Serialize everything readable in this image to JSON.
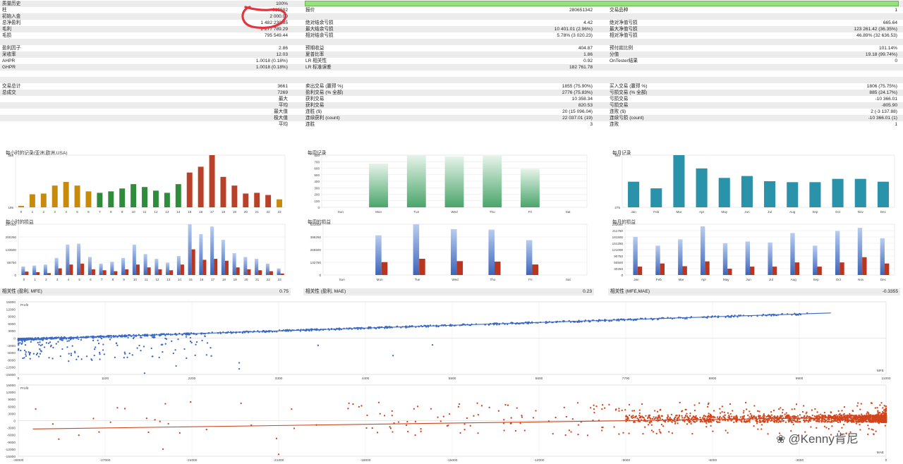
{
  "stats": {
    "rows": [
      {
        "cells": [
          {
            "t": "质量历史",
            "x": 3,
            "a": "l"
          },
          {
            "t": "100%",
            "x": 408,
            "a": "r"
          }
        ]
      },
      {
        "cells": [
          {
            "t": "柱",
            "x": 3,
            "a": "l"
          },
          {
            "t": "615592",
            "x": 408,
            "a": "r"
          },
          {
            "t": "报价",
            "x": 433,
            "a": "l"
          },
          {
            "t": "280651342",
            "x": 840,
            "a": "r"
          },
          {
            "t": "交易品种",
            "x": 864,
            "a": "l"
          },
          {
            "t": "1",
            "x": 1272,
            "a": "r"
          }
        ]
      },
      {
        "cells": [
          {
            "t": "初始入金",
            "x": 3,
            "a": "l"
          },
          {
            "t": "2 000.00",
            "x": 408,
            "a": "r"
          }
        ]
      },
      {
        "cells": [
          {
            "t": "总净盈利",
            "x": 3,
            "a": "l"
          },
          {
            "t": "1 482 239.85",
            "x": 408,
            "a": "r"
          },
          {
            "t": "绝对结余亏损",
            "x": 433,
            "a": "l"
          },
          {
            "t": "4.42",
            "x": 840,
            "a": "r"
          },
          {
            "t": "绝对净值亏损",
            "x": 864,
            "a": "l"
          },
          {
            "t": "665.64",
            "x": 1272,
            "a": "r"
          }
        ]
      },
      {
        "cells": [
          {
            "t": "毛利",
            "x": 3,
            "a": "l"
          },
          {
            "t": "2 277 789.29",
            "x": 408,
            "a": "r"
          },
          {
            "t": "最大结余亏损",
            "x": 433,
            "a": "l"
          },
          {
            "t": "10 401.01 (2.96%)",
            "x": 840,
            "a": "r"
          },
          {
            "t": "最大净值亏损",
            "x": 864,
            "a": "l"
          },
          {
            "t": "123 261.42 (36.35%)",
            "x": 1272,
            "a": "r"
          }
        ]
      },
      {
        "cells": [
          {
            "t": "毛损",
            "x": 3,
            "a": "l"
          },
          {
            "t": "795 549.44",
            "x": 408,
            "a": "r"
          },
          {
            "t": "相对结余亏损",
            "x": 433,
            "a": "l"
          },
          {
            "t": "5.78% (3 020.23)",
            "x": 840,
            "a": "r"
          },
          {
            "t": "相对净值亏损",
            "x": 864,
            "a": "l"
          },
          {
            "t": "46.89% (32 636.53)",
            "x": 1272,
            "a": "r"
          }
        ]
      },
      {
        "cells": []
      },
      {
        "cells": [
          {
            "t": "盈利因子",
            "x": 3,
            "a": "l"
          },
          {
            "t": "2.86",
            "x": 408,
            "a": "r"
          },
          {
            "t": "预期收益",
            "x": 433,
            "a": "l"
          },
          {
            "t": "404.87",
            "x": 840,
            "a": "r"
          },
          {
            "t": "预付款比例",
            "x": 864,
            "a": "l"
          },
          {
            "t": "101.14%",
            "x": 1272,
            "a": "r"
          }
        ]
      },
      {
        "cells": [
          {
            "t": "采收率",
            "x": 3,
            "a": "l"
          },
          {
            "t": "12.03",
            "x": 408,
            "a": "r"
          },
          {
            "t": "夏普比率",
            "x": 433,
            "a": "l"
          },
          {
            "t": "1.86",
            "x": 840,
            "a": "r"
          },
          {
            "t": "分值",
            "x": 864,
            "a": "l"
          },
          {
            "t": "19.18 (99.74%)",
            "x": 1272,
            "a": "r"
          }
        ]
      },
      {
        "cells": [
          {
            "t": "AHPR",
            "x": 3,
            "a": "l"
          },
          {
            "t": "1.0018 (0.18%)",
            "x": 408,
            "a": "r"
          },
          {
            "t": "LR 相关性",
            "x": 433,
            "a": "l"
          },
          {
            "t": "0.92",
            "x": 840,
            "a": "r"
          },
          {
            "t": "OnTester结果",
            "x": 864,
            "a": "l"
          },
          {
            "t": "0",
            "x": 1272,
            "a": "r"
          }
        ]
      },
      {
        "cells": [
          {
            "t": "GHPR",
            "x": 3,
            "a": "l"
          },
          {
            "t": "1.0018 (0.18%)",
            "x": 408,
            "a": "r"
          },
          {
            "t": "LR 标准误差",
            "x": 433,
            "a": "l"
          },
          {
            "t": "182 761.78",
            "x": 840,
            "a": "r"
          }
        ]
      },
      {
        "cells": []
      },
      {
        "cells": []
      },
      {
        "cells": [
          {
            "t": "交易总计",
            "x": 3,
            "a": "l"
          },
          {
            "t": "3661",
            "x": 408,
            "a": "r"
          },
          {
            "t": "卖出交易 (赢得 %)",
            "x": 433,
            "a": "l"
          },
          {
            "t": "1855 (75.90%)",
            "x": 840,
            "a": "r"
          },
          {
            "t": "买入交易 (赢得 %)",
            "x": 864,
            "a": "l"
          },
          {
            "t": "1806 (75.75%)",
            "x": 1272,
            "a": "r"
          }
        ]
      },
      {
        "cells": [
          {
            "t": "总成交",
            "x": 3,
            "a": "l"
          },
          {
            "t": "7269",
            "x": 408,
            "a": "r"
          },
          {
            "t": "盈利交易 (% 全部)",
            "x": 433,
            "a": "l"
          },
          {
            "t": "2776 (75.83%)",
            "x": 840,
            "a": "r"
          },
          {
            "t": "亏损交易 (% 全部)",
            "x": 864,
            "a": "l"
          },
          {
            "t": "885 (24.17%)",
            "x": 1272,
            "a": "r"
          }
        ]
      },
      {
        "cells": [
          {
            "t": "最大",
            "x": 408,
            "a": "r"
          },
          {
            "t": "获利交易",
            "x": 433,
            "a": "l"
          },
          {
            "t": "10 358.34",
            "x": 840,
            "a": "r"
          },
          {
            "t": "亏损交易",
            "x": 864,
            "a": "l"
          },
          {
            "t": "-10 366.01",
            "x": 1272,
            "a": "r"
          }
        ]
      },
      {
        "cells": [
          {
            "t": "平均",
            "x": 408,
            "a": "r"
          },
          {
            "t": "获利交易",
            "x": 433,
            "a": "l"
          },
          {
            "t": "820.53",
            "x": 840,
            "a": "r"
          },
          {
            "t": "亏损交易",
            "x": 864,
            "a": "l"
          },
          {
            "t": "-805.90",
            "x": 1272,
            "a": "r"
          }
        ]
      },
      {
        "cells": [
          {
            "t": "最大值",
            "x": 408,
            "a": "r"
          },
          {
            "t": "连胜 ($)",
            "x": 433,
            "a": "l"
          },
          {
            "t": "20 (15 096.04)",
            "x": 840,
            "a": "r"
          },
          {
            "t": "连败 ($)",
            "x": 864,
            "a": "l"
          },
          {
            "t": "2 (-3 137.88)",
            "x": 1272,
            "a": "r"
          }
        ]
      },
      {
        "cells": [
          {
            "t": "极大值",
            "x": 408,
            "a": "r"
          },
          {
            "t": "连续获利 (count)",
            "x": 433,
            "a": "l"
          },
          {
            "t": "22 037.01 (19)",
            "x": 840,
            "a": "r"
          },
          {
            "t": "连续亏损 (count)",
            "x": 864,
            "a": "l"
          },
          {
            "t": "-10 366.01 (1)",
            "x": 1272,
            "a": "r"
          }
        ]
      },
      {
        "cells": [
          {
            "t": "平均",
            "x": 408,
            "a": "r"
          },
          {
            "t": "连胜",
            "x": 433,
            "a": "l"
          },
          {
            "t": "3",
            "x": 840,
            "a": "r"
          },
          {
            "t": "连败",
            "x": 864,
            "a": "l"
          },
          {
            "t": "1",
            "x": 1272,
            "a": "r"
          }
        ]
      }
    ]
  },
  "quality_bar_pct": 100,
  "annotation_color": "#e8323c",
  "colors": {
    "hour_bars": [
      "#c78a0c",
      "#c78a0c",
      "#c78a0c",
      "#c78a0c",
      "#c78a0c",
      "#c78a0c",
      "#c78a0c",
      "#2f8c3a",
      "#2f8c3a",
      "#2f8c3a",
      "#2f8c3a",
      "#2f8c3a",
      "#2f8c3a",
      "#2f8c3a",
      "#2f8c3a",
      "#b9412a",
      "#b9412a",
      "#b9412a",
      "#b9412a",
      "#b9412a",
      "#b9412a",
      "#b9412a",
      "#b9412a",
      "#c78a0c"
    ],
    "week_bar": "#4aa56a",
    "month_bar": "#2b93a9",
    "pl_profit": "#3c64b8",
    "pl_loss": "#b8361f",
    "mfe_points": "#3a68c4",
    "mae_points": "#d0451c"
  },
  "chart_data": [
    {
      "id": "hour_records",
      "type": "bar",
      "title": "每小时的记录(亚洲,欧洲,USA)",
      "categories": [
        "0",
        "1",
        "2",
        "3",
        "4",
        "5",
        "6",
        "7",
        "8",
        "9",
        "10",
        "11",
        "12",
        "13",
        "14",
        "15",
        "16",
        "17",
        "18",
        "19",
        "20",
        "21",
        "22",
        "23"
      ],
      "values": [
        10,
        90,
        95,
        150,
        175,
        150,
        110,
        100,
        110,
        130,
        160,
        140,
        115,
        100,
        160,
        240,
        280,
        360,
        210,
        150,
        95,
        100,
        85,
        55
      ],
      "yticks": [
        "388",
        "195"
      ],
      "ylim": [
        0,
        360
      ]
    },
    {
      "id": "week_records",
      "type": "bar",
      "title": "每周记录",
      "categories": [
        "Sun",
        "Mon",
        "Tue",
        "Wed",
        "Thu",
        "Fri",
        "Sat"
      ],
      "values": [
        0,
        670,
        800,
        780,
        790,
        590,
        0
      ],
      "yticks": [
        "800",
        "700",
        "600",
        "500",
        "400",
        "300",
        "200",
        "100",
        "0"
      ],
      "ylim": [
        0,
        800
      ]
    },
    {
      "id": "month_records",
      "type": "bar",
      "title": "每月记录",
      "categories": [
        "Jan",
        "Feb",
        "Mar",
        "Apr",
        "May",
        "Jun",
        "Jul",
        "Aug",
        "Sep",
        "Oct",
        "Nov",
        "Dec"
      ],
      "values": [
        270,
        200,
        550,
        410,
        310,
        330,
        275,
        265,
        265,
        300,
        300,
        270
      ],
      "yticks": [
        "550",
        "275"
      ],
      "ylim": [
        0,
        550
      ]
    },
    {
      "id": "hour_pl",
      "type": "bar",
      "title": "每小时的损益",
      "categories": [
        "0",
        "1",
        "2",
        "3",
        "4",
        "5",
        "6",
        "7",
        "8",
        "9",
        "10",
        "11",
        "12",
        "13",
        "14",
        "15",
        "16",
        "17",
        "18",
        "19",
        "20",
        "21",
        "22",
        "23"
      ],
      "series": [
        {
          "values": [
            45000,
            50000,
            55000,
            90000,
            160000,
            165000,
            95000,
            60000,
            70000,
            90000,
            160000,
            110000,
            85000,
            65000,
            100000,
            267000,
            215000,
            255000,
            185000,
            115000,
            95000,
            85000,
            60000,
            35000
          ]
        },
        {
          "values": [
            18000,
            15000,
            10000,
            35000,
            55000,
            60000,
            30000,
            25000,
            20000,
            30000,
            55000,
            40000,
            30000,
            25000,
            55000,
            135000,
            80000,
            85000,
            75000,
            40000,
            30000,
            25000,
            20000,
            8000
          ]
        }
      ],
      "yticks": [
        "267000",
        "200250",
        "133500",
        "66750",
        "0"
      ],
      "ylim": [
        0,
        267000
      ]
    },
    {
      "id": "week_pl",
      "type": "bar",
      "title": "每周的损益",
      "categories": [
        "Sun",
        "Mon",
        "Tue",
        "Wed",
        "Thu",
        "Fri",
        "Sat"
      ],
      "series": [
        {
          "values": [
            0,
            415000,
            531000,
            480000,
            475000,
            365000,
            0
          ]
        },
        {
          "values": [
            0,
            135000,
            170000,
            145000,
            140000,
            110000,
            0
          ]
        }
      ],
      "yticks": [
        "531000",
        "398250",
        "265500",
        "132750",
        "0"
      ],
      "ylim": [
        0,
        531000
      ]
    },
    {
      "id": "month_pl",
      "type": "bar",
      "title": "每月的损益",
      "categories": [
        "Jan",
        "Feb",
        "Mar",
        "Apr",
        "May",
        "Jun",
        "Jul",
        "Aug",
        "Sep",
        "Oct",
        "Nov",
        "Dec"
      ],
      "series": [
        {
          "values": [
            182000,
            140000,
            170000,
            232000,
            152000,
            160000,
            155000,
            200000,
            140000,
            210000,
            225000,
            175000
          ]
        },
        {
          "values": [
            40000,
            55000,
            42000,
            65000,
            30000,
            40000,
            40000,
            60000,
            40000,
            60000,
            85000,
            55000
          ]
        }
      ],
      "yticks": [
        "242000",
        "211750",
        "181500",
        "151250",
        "121000",
        "90750",
        "60500",
        "30250",
        "0"
      ],
      "ylim": [
        0,
        242000
      ]
    },
    {
      "id": "corr_mfe",
      "type": "scatter",
      "title": "相关性 (盈利, MFE)",
      "corr_value": "0.75",
      "ylabel": "Profit",
      "xlabel": "MFE",
      "yticks": [
        "15000",
        "12000",
        "9000",
        "6000",
        "3000",
        "0",
        "-3000",
        "-6000",
        "-9000",
        "-12000",
        "-15000"
      ],
      "xticks": [
        "0",
        "1100",
        "2200",
        "3300",
        "4400",
        "5500",
        "6600",
        "7700",
        "8800",
        "9900",
        "11000"
      ],
      "xlim": [
        0,
        11000
      ],
      "ylim": [
        -15000,
        15000
      ],
      "trend": [
        [
          0,
          -500
        ],
        [
          10300,
          10400
        ]
      ],
      "seed": 7
    },
    {
      "id": "corr_mae",
      "type": "scatter",
      "title": "相关性 (盈利, MAE)",
      "corr_value": "0.23",
      "ylabel": "Profit",
      "xlabel": "MAE",
      "yticks": [
        "15000",
        "12000",
        "9000",
        "6000",
        "3000",
        "0",
        "-3000",
        "-6000",
        "-9000",
        "-12000",
        "-15000"
      ],
      "xticks": [
        "-30000",
        "-27000",
        "-24000",
        "-21000",
        "-18000",
        "-15000",
        "-12000",
        "-9000",
        "-6000",
        "-3000",
        "0"
      ],
      "xlim": [
        -30000,
        0
      ],
      "ylim": [
        -15000,
        15000
      ],
      "trend": [
        [
          -29500,
          -3500
        ],
        [
          0,
          1500
        ]
      ],
      "seed": 11
    },
    {
      "id": "corr_mfe_mae",
      "title": "相关性 (MFE,MAE)",
      "corr_value": "-0.3355"
    }
  ],
  "watermark": {
    "icon": "❀",
    "text": "@Kenny肯尼"
  }
}
